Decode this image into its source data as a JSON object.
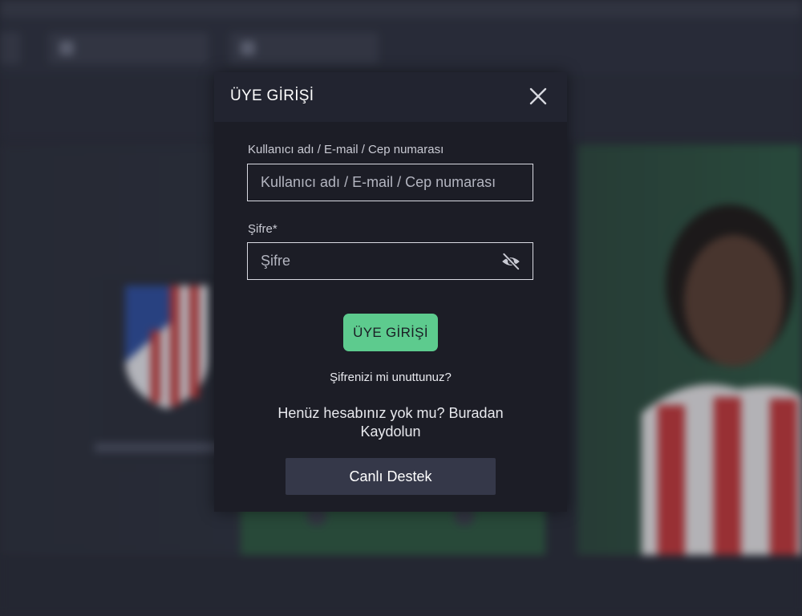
{
  "modal": {
    "title": "ÜYE GİRİŞİ",
    "close_icon": "close-icon",
    "username": {
      "label": "Kullanıcı adı / E-mail / Cep numarası",
      "placeholder": "Kullanıcı adı / E-mail / Cep numarası",
      "value": ""
    },
    "password": {
      "label": "Şifre*",
      "placeholder": "Şifre",
      "value": "",
      "toggle_icon": "eye-off-icon"
    },
    "login_button": "ÜYE GİRİŞİ",
    "forgot_password": "Şifrenizi mi unuttunuz?",
    "register_prompt": "Henüz hesabınız yok mu?",
    "register_link": "Buradan Kaydolun",
    "support_button": "Canlı Destek"
  },
  "colors": {
    "modal_bg": "#1c1d26",
    "header_bg": "#222430",
    "login_button_bg": "#5dcb8e",
    "support_button_bg": "#353849"
  }
}
